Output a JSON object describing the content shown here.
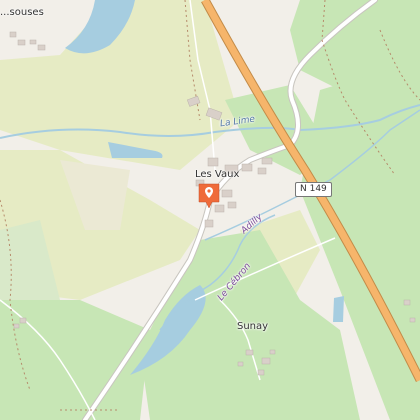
{
  "map": {
    "labels": {
      "top_left_village": "...souses",
      "les_vaux": "Les Vaux",
      "sunay": "Sunay",
      "la_lime": "La Lime",
      "adilly": "Adilly",
      "le_cebron": "Le Cébron"
    },
    "road_ref": "N 149",
    "marker_icon": "location-pin-icon",
    "colors": {
      "background": "#f2efe9",
      "meadow": "#e6ebc4",
      "forest": "#c7e6b5",
      "water": "#a6cde0",
      "trunk_road": "#f6b56b",
      "trunk_casing": "#c28b48",
      "minor_road": "#ffffff",
      "marker": "#ef6b3a"
    }
  }
}
